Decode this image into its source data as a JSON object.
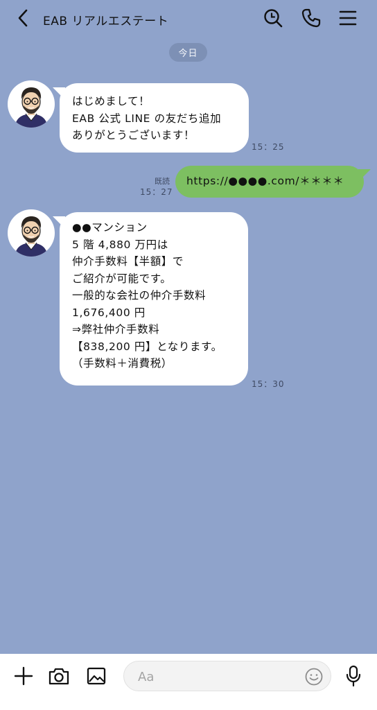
{
  "header": {
    "title": "EAB リアルエステート"
  },
  "date_chip": "今日",
  "messages": [
    {
      "text": "はじめまして！\nEAB 公式 LINE の友だち追加\nありがとうございます！",
      "time": "15：25"
    },
    {
      "text": "https://●●●●.com/＊＊＊＊",
      "read": "既読",
      "time": "15：27"
    },
    {
      "text": "●●マンション\n5 階 4,880 万円は\n仲介手数料【半額】で\nご紹介が可能です。\n一般的な会社の仲介手数料\n1,676,400 円\n⇒弊社仲介手数料\n【838,200 円】となります。\n（手数料＋消費税）",
      "time": "15：30"
    }
  ],
  "input": {
    "placeholder": "Aa"
  },
  "colors": {
    "background": "#8fa3cb",
    "outgoing_bubble": "#7dbf61",
    "incoming_bubble": "#ffffff"
  },
  "icons": {
    "back": "chevron-left-icon",
    "search": "search-icon",
    "call": "phone-icon",
    "menu": "menu-icon",
    "plus": "plus-icon",
    "camera": "camera-icon",
    "image": "image-icon",
    "emoji": "emoji-icon",
    "mic": "microphone-icon"
  }
}
